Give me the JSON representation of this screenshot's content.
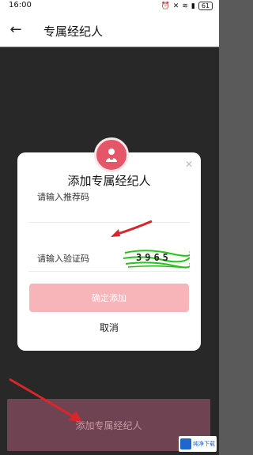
{
  "status": {
    "time": "16:00",
    "battery": "61"
  },
  "header": {
    "title": "专属经纪人"
  },
  "dialog": {
    "title": "添加专属经纪人",
    "referral_placeholder": "请输入推荐码",
    "code_placeholder": "请输入验证码",
    "captcha_text": "3965",
    "confirm_label": "确定添加",
    "cancel_label": "取消"
  },
  "bottom": {
    "button_label": "添加专属经纪人"
  },
  "watermark": {
    "text": "纯净下载"
  },
  "colors": {
    "accent": "#e55668",
    "confirm_bg": "#f7b5ba",
    "arrow": "#d9262a",
    "bottom_bg": "#6f4352"
  }
}
